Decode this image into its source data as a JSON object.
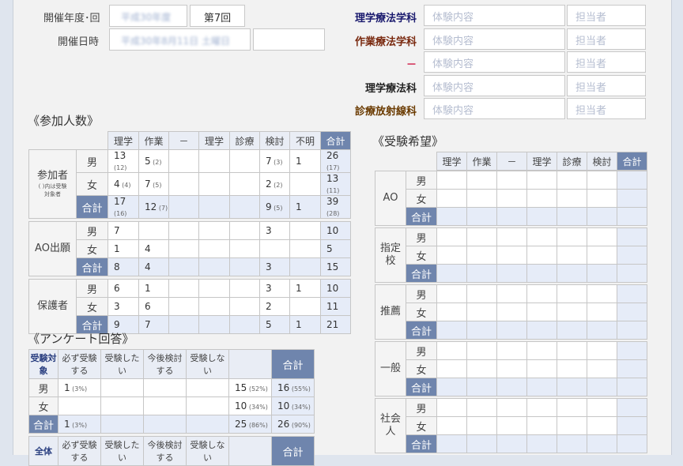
{
  "header": {
    "year_label": "開催年度･回",
    "year_value": "平成30年度",
    "round": "第7回",
    "date_label": "開催日時",
    "date_value": "平成30年8月11日 土曜日"
  },
  "departments": [
    {
      "name": "理学療法学科",
      "color": "#1a1a6e",
      "content_placeholder": "体験内容",
      "person_placeholder": "担当者"
    },
    {
      "name": "作業療法学科",
      "color": "#7a2a10",
      "content_placeholder": "体験内容",
      "person_placeholder": "担当者"
    },
    {
      "name": "－",
      "color": "#d0204a",
      "content_placeholder": "体験内容",
      "person_placeholder": "担当者"
    },
    {
      "name": "理学療法科",
      "color": "#222222",
      "content_placeholder": "体験内容",
      "person_placeholder": "担当者"
    },
    {
      "name": "診療放射線科",
      "color": "#6a3a00",
      "content_placeholder": "体験内容",
      "person_placeholder": "担当者"
    }
  ],
  "participants": {
    "title": "《参加人数》",
    "columns": [
      "理学",
      "作業",
      "－",
      "理学",
      "診療",
      "検討",
      "不明",
      "合計"
    ],
    "groups": [
      {
        "label": "参加者",
        "note": "( )内は受験",
        "note2": "対象者",
        "rows": [
          {
            "label": "男",
            "cells": [
              {
                "v": "13",
                "s": "(12)"
              },
              {
                "v": "5",
                "s": "(2)"
              },
              {
                "v": "",
                "s": ""
              },
              {
                "v": "",
                "s": ""
              },
              {
                "v": "",
                "s": ""
              },
              {
                "v": "7",
                "s": "(3)"
              },
              {
                "v": "1",
                "s": ""
              },
              {
                "v": "26",
                "s": "(17)"
              }
            ]
          },
          {
            "label": "女",
            "cells": [
              {
                "v": "4",
                "s": "(4)"
              },
              {
                "v": "7",
                "s": "(5)"
              },
              {
                "v": "",
                "s": ""
              },
              {
                "v": "",
                "s": ""
              },
              {
                "v": "",
                "s": ""
              },
              {
                "v": "2",
                "s": "(2)"
              },
              {
                "v": "",
                "s": ""
              },
              {
                "v": "13",
                "s": "(11)"
              }
            ]
          },
          {
            "label": "合計",
            "cells": [
              {
                "v": "17",
                "s": "(16)"
              },
              {
                "v": "12",
                "s": "(7)"
              },
              {
                "v": "",
                "s": ""
              },
              {
                "v": "",
                "s": ""
              },
              {
                "v": "",
                "s": ""
              },
              {
                "v": "9",
                "s": "(5)"
              },
              {
                "v": "1",
                "s": ""
              },
              {
                "v": "39",
                "s": "(28)"
              }
            ]
          }
        ]
      },
      {
        "label": "AO出願",
        "rows": [
          {
            "label": "男",
            "cells": [
              {
                "v": "7"
              },
              {
                "v": ""
              },
              {
                "v": ""
              },
              {
                "v": ""
              },
              {
                "v": ""
              },
              {
                "v": "3"
              },
              {
                "v": ""
              },
              {
                "v": "10"
              }
            ]
          },
          {
            "label": "女",
            "cells": [
              {
                "v": "1"
              },
              {
                "v": "4"
              },
              {
                "v": ""
              },
              {
                "v": ""
              },
              {
                "v": ""
              },
              {
                "v": ""
              },
              {
                "v": ""
              },
              {
                "v": "5"
              }
            ]
          },
          {
            "label": "合計",
            "cells": [
              {
                "v": "8"
              },
              {
                "v": "4"
              },
              {
                "v": ""
              },
              {
                "v": ""
              },
              {
                "v": ""
              },
              {
                "v": "3"
              },
              {
                "v": ""
              },
              {
                "v": "15"
              }
            ]
          }
        ]
      },
      {
        "label": "保護者",
        "rows": [
          {
            "label": "男",
            "cells": [
              {
                "v": "6"
              },
              {
                "v": "1"
              },
              {
                "v": ""
              },
              {
                "v": ""
              },
              {
                "v": ""
              },
              {
                "v": "3"
              },
              {
                "v": "1"
              },
              {
                "v": "10"
              }
            ]
          },
          {
            "label": "女",
            "cells": [
              {
                "v": "3"
              },
              {
                "v": "6"
              },
              {
                "v": ""
              },
              {
                "v": ""
              },
              {
                "v": ""
              },
              {
                "v": "2"
              },
              {
                "v": ""
              },
              {
                "v": "11"
              }
            ]
          },
          {
            "label": "合計",
            "cells": [
              {
                "v": "9"
              },
              {
                "v": "7"
              },
              {
                "v": ""
              },
              {
                "v": ""
              },
              {
                "v": ""
              },
              {
                "v": "5"
              },
              {
                "v": "1"
              },
              {
                "v": "21"
              }
            ]
          }
        ]
      }
    ]
  },
  "survey": {
    "title": "《アンケート回答》",
    "header": [
      "受験対象",
      "必ず受験する",
      "受験したい",
      "今後検討する",
      "受験しない",
      "",
      "合計"
    ],
    "rows": [
      {
        "label": "男",
        "cells": [
          {
            "v": "1",
            "s": "(3%)"
          },
          {
            "v": "",
            "s": ""
          },
          {
            "v": "",
            "s": ""
          },
          {
            "v": "",
            "s": ""
          },
          {
            "v": "15",
            "s": "(52%)"
          },
          {
            "v": "16",
            "s": "(55%)"
          }
        ]
      },
      {
        "label": "女",
        "cells": [
          {
            "v": "",
            "s": ""
          },
          {
            "v": "",
            "s": ""
          },
          {
            "v": "",
            "s": ""
          },
          {
            "v": "",
            "s": ""
          },
          {
            "v": "10",
            "s": "(34%)"
          },
          {
            "v": "10",
            "s": "(34%)"
          }
        ]
      },
      {
        "label": "合計",
        "cells": [
          {
            "v": "1",
            "s": "(3%)"
          },
          {
            "v": "",
            "s": ""
          },
          {
            "v": "",
            "s": ""
          },
          {
            "v": "",
            "s": ""
          },
          {
            "v": "25",
            "s": "(86%)"
          },
          {
            "v": "26",
            "s": "(90%)"
          }
        ]
      }
    ],
    "header2": [
      "全体",
      "必ず受験する",
      "受験したい",
      "今後検討する",
      "受験しない",
      "",
      "合計"
    ]
  },
  "exam_hope": {
    "title": "《受験希望》",
    "columns": [
      "理学",
      "作業",
      "－",
      "理学",
      "診療",
      "検討",
      "合計"
    ],
    "groups": [
      "AO",
      "指定校",
      "推薦",
      "一般",
      "社会人"
    ],
    "row_labels": [
      "男",
      "女",
      "合計"
    ]
  }
}
